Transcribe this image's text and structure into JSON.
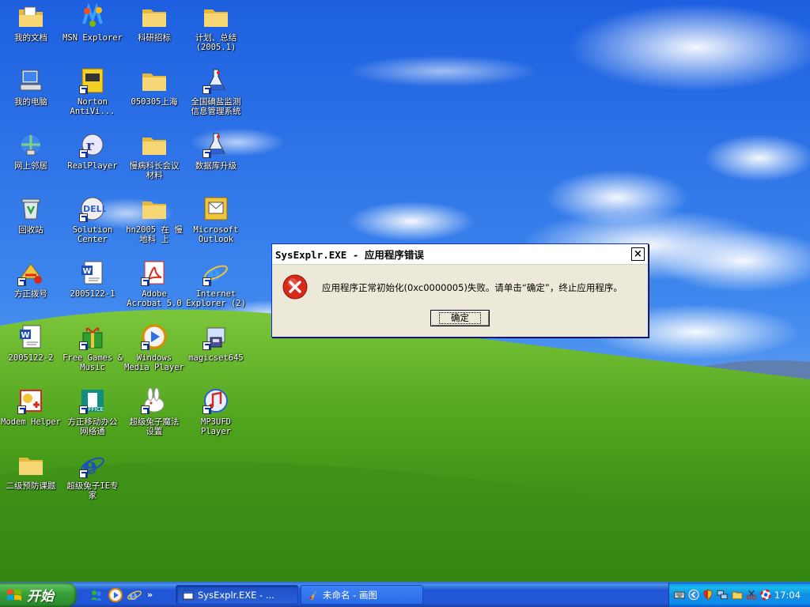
{
  "desktop": {
    "icons": [
      {
        "label": "我的文档",
        "icon": "my-documents-icon"
      },
      {
        "label": "MSN Explorer",
        "icon": "msn-icon"
      },
      {
        "label": "科研招标",
        "icon": "folder-icon"
      },
      {
        "label": "计划、总结\n(2005.1)",
        "icon": "folder-icon"
      },
      {
        "label": "我的电脑",
        "icon": "my-computer-icon"
      },
      {
        "label": "Norton\nAntiVi...",
        "icon": "norton-icon"
      },
      {
        "label": "050305上海",
        "icon": "folder-icon"
      },
      {
        "label": "全国碘盐监测\n信息管理系统",
        "icon": "flask-icon"
      },
      {
        "label": "网上邻居",
        "icon": "network-icon"
      },
      {
        "label": "RealPlayer",
        "icon": "realplayer-icon"
      },
      {
        "label": "慢病科长会议\n材料",
        "icon": "folder-icon"
      },
      {
        "label": "数据库升级",
        "icon": "flask-icon"
      },
      {
        "label": "回收站",
        "icon": "recycle-bin-icon"
      },
      {
        "label": "Solution\nCenter",
        "icon": "dell-icon"
      },
      {
        "label": "hn2005 在 慢\n地科 上",
        "icon": "folder-icon"
      },
      {
        "label": "Microsoft\nOutlook",
        "icon": "outlook-icon"
      },
      {
        "label": "方正拨号",
        "icon": "dialup-icon"
      },
      {
        "label": "2005122-1",
        "icon": "word-doc-icon"
      },
      {
        "label": "Adobe\nAcrobat 5.0",
        "icon": "acrobat-icon"
      },
      {
        "label": "Internet\nExplorer (2)",
        "icon": "ie-icon"
      },
      {
        "label": "2005122-2",
        "icon": "word-doc-icon"
      },
      {
        "label": "Free Games &\nMusic",
        "icon": "gift-icon"
      },
      {
        "label": "Windows\nMedia Player",
        "icon": "media-player-icon"
      },
      {
        "label": "magicset645",
        "icon": "setup-icon"
      },
      {
        "label": "Modem Helper",
        "icon": "modem-helper-icon"
      },
      {
        "label": "方正移动办公\n网络通",
        "icon": "mobile-office-icon"
      },
      {
        "label": "超级兔子魔法\n设置",
        "icon": "rabbit-icon"
      },
      {
        "label": "MP3UFD\nPlayer",
        "icon": "mp3-icon"
      },
      {
        "label": "二级预防课题",
        "icon": "folder-icon"
      },
      {
        "label": "超级兔子IE专\n家",
        "icon": "ie-expert-icon"
      }
    ]
  },
  "dialog": {
    "title": "SysExplr.EXE - 应用程序错误",
    "message": "应用程序正常初始化(0xc0000005)失败。请单击“确定”，终止应用程序。",
    "ok_label": "确定",
    "close_label": "×"
  },
  "taskbar": {
    "start_label": "开始",
    "quick_launch": [
      "messenger-icon",
      "media-player-icon",
      "ie-icon"
    ],
    "more_label": "»",
    "tasks": [
      {
        "label": "SysExplr.EXE - ...",
        "icon": "window-icon",
        "active": true
      },
      {
        "label": "未命名 - 画图",
        "icon": "paint-icon",
        "active": false
      }
    ],
    "tray_icons": [
      "keyboard-icon",
      "back-arrow-icon",
      "security-icon",
      "network-icon",
      "folder-tray-icon",
      "scissors-icon",
      "lifebuoy-icon"
    ],
    "clock": "17:04"
  },
  "colors": {
    "sky": "#2f6fe0",
    "grass": "#3c9a1e",
    "dialog_bg": "#ece9d8",
    "taskbar": "#2157d7",
    "start": "#37a137",
    "error_red": "#d62a1a"
  }
}
